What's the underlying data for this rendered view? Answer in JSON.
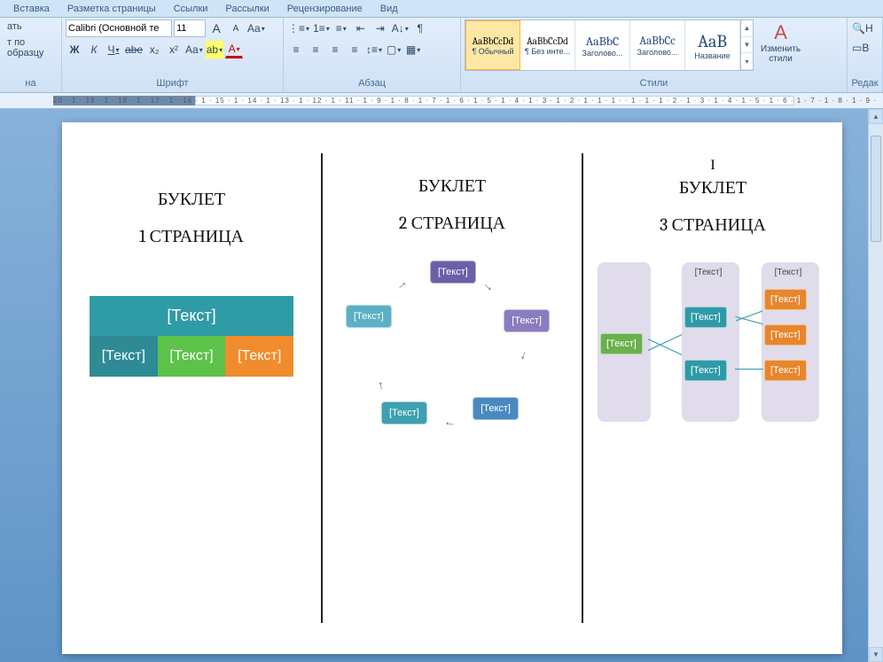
{
  "tabs": [
    "Вставка",
    "Разметка страницы",
    "Ссылки",
    "Рассылки",
    "Рецензирование",
    "Вид"
  ],
  "clipboard": {
    "paste": "ать",
    "brush": "т по образцу",
    "label": "на"
  },
  "font": {
    "name": "Calibri (Основной те",
    "size": "11",
    "label": "Шрифт",
    "bold": "Ж",
    "italic": "К",
    "under": "Ч",
    "strike": "abe",
    "sub": "x₂",
    "sup": "x²",
    "case": "Aa",
    "hl": "ab",
    "color": "A",
    "grow": "A",
    "shrink": "A",
    "clear": "Aa"
  },
  "para": {
    "label": "Абзац"
  },
  "styles": {
    "label": "Стили",
    "items": [
      {
        "prev": "AaBbCcDd",
        "name": "¶ Обычный",
        "sel": true,
        "size": "11px",
        "color": "#000"
      },
      {
        "prev": "AaBbCcDd",
        "name": "¶ Без инте...",
        "sel": false,
        "size": "11px",
        "color": "#000"
      },
      {
        "prev": "AaBbC",
        "name": "Заголово...",
        "sel": false,
        "size": "14px",
        "color": "#1f497d"
      },
      {
        "prev": "AaBbCc",
        "name": "Заголово...",
        "sel": false,
        "size": "13px",
        "color": "#1f497d"
      },
      {
        "prev": "AaB",
        "name": "Название",
        "sel": false,
        "size": "20px",
        "color": "#1f497d"
      }
    ],
    "change": "Изменить\nстили"
  },
  "editing": {
    "label": "Редак",
    "find": "Н",
    "sel": "В"
  },
  "ruler": "20 · 1 · 19 · 1 · 18 · 1 · 17 · 1 · 16 · 1 · 15 · 1 · 14 · 1 · 13 · 1 · 12 · 1 · 11      · 1 · 9 · 1 · 8 · 1 · 7 · 1 · 6 · 1 · 5 · 1 · 4 · 1 · 3 · 1 · 2 · 1 · 1 · 1 ·     · 1 · 1 · 1 · 2 · 1 · 3 · 1 · 4 · 1 · 5 · 1 · 6 · 1 · 7 · 1 · 8 · 1 · 9 ·",
  "doc": {
    "p1": {
      "t": "БУКЛЕТ",
      "s": "1 СТРАНИЦА",
      "ph": "[Текст]"
    },
    "p2": {
      "t": "БУКЛЕТ",
      "s": "2 СТРАНИЦА",
      "ph": "[Текст]"
    },
    "p3": {
      "i": "І",
      "t": "БУКЛЕТ",
      "s": "3 СТРАНИЦА",
      "ph": "[Текст]"
    }
  }
}
